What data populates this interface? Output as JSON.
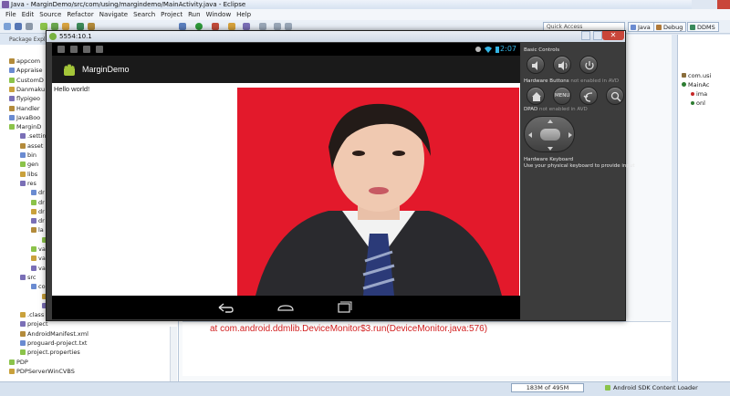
{
  "window": {
    "title": "Java - MarginDemo/src/com/using/margindemo/MainActivity.java - Eclipse"
  },
  "menu": [
    "File",
    "Edit",
    "Source",
    "Refactor",
    "Navigate",
    "Search",
    "Project",
    "Run",
    "Window",
    "Help"
  ],
  "toolbar": {
    "quick_access_placeholder": "Quick Access",
    "perspectives": [
      {
        "label": "Java",
        "color": "#6a8bd1"
      },
      {
        "label": "Debug",
        "color": "#b07a3a"
      },
      {
        "label": "DDMS",
        "color": "#3a8a5c"
      }
    ]
  },
  "package_explorer": {
    "title": "Package Explo",
    "rows": [
      {
        "label": "appcom",
        "indent": 0
      },
      {
        "label": "Appraise",
        "indent": 0
      },
      {
        "label": "CustomD",
        "indent": 0
      },
      {
        "label": "Danmaku",
        "indent": 0
      },
      {
        "label": "flypigeo",
        "indent": 0
      },
      {
        "label": "Handler",
        "indent": 0
      },
      {
        "label": "JavaBoo",
        "indent": 0
      },
      {
        "label": "MarginD",
        "indent": 0
      },
      {
        "label": ".settin",
        "indent": 1
      },
      {
        "label": "asset",
        "indent": 1
      },
      {
        "label": "bin",
        "indent": 1
      },
      {
        "label": "gen",
        "indent": 1
      },
      {
        "label": "libs",
        "indent": 1
      },
      {
        "label": "res",
        "indent": 1
      },
      {
        "label": "dr",
        "indent": 2
      },
      {
        "label": "dr",
        "indent": 2
      },
      {
        "label": "dr",
        "indent": 2
      },
      {
        "label": "dr",
        "indent": 2
      },
      {
        "label": "la",
        "indent": 2
      },
      {
        "label": "",
        "indent": 3
      },
      {
        "label": "va",
        "indent": 2
      },
      {
        "label": "va",
        "indent": 2
      },
      {
        "label": "va",
        "indent": 2
      },
      {
        "label": "src",
        "indent": 1
      },
      {
        "label": "co",
        "indent": 2
      },
      {
        "label": "",
        "indent": 3
      },
      {
        "label": "",
        "indent": 3
      },
      {
        "label": ".class",
        "indent": 1
      },
      {
        "label": "project",
        "indent": 1
      },
      {
        "label": "AndroidManifest.xml",
        "indent": 1
      },
      {
        "label": "proguard-project.txt",
        "indent": 1
      },
      {
        "label": "project.properties",
        "indent": 1
      },
      {
        "label": "PDP",
        "indent": 0
      },
      {
        "label": "PDPServerWinCVBS",
        "indent": 0
      }
    ]
  },
  "outline": {
    "rows": [
      {
        "label": "com.usi",
        "color": "#8a6d3b"
      },
      {
        "label": "MainAc",
        "color": "#2e7d32"
      },
      {
        "label": "ima",
        "color": "#c62828"
      },
      {
        "label": "onl",
        "color": "#2e7d32"
      }
    ]
  },
  "console": {
    "line": "at com.android.ddmlib.DeviceMonitor$3.run(DeviceMonitor.java:576)"
  },
  "status": {
    "heap": "183M of 495M",
    "loader": "Android SDK Content Loader"
  },
  "emulator": {
    "title": "5554:10.1",
    "time": "2:07",
    "app_title": "MarginDemo",
    "hello_text": "Hello world!",
    "controls": {
      "basic_label": "Basic Controls",
      "hw_buttons_label": "Hardware Buttons",
      "hw_buttons_note": "not enabled in AVD",
      "dpad_label": "DPAD",
      "dpad_note": "not enabled in AVD",
      "keyboard_label": "Hardware Keyboard",
      "keyboard_note": "Use your physical keyboard to provide input",
      "menu_label": "MENU"
    }
  }
}
